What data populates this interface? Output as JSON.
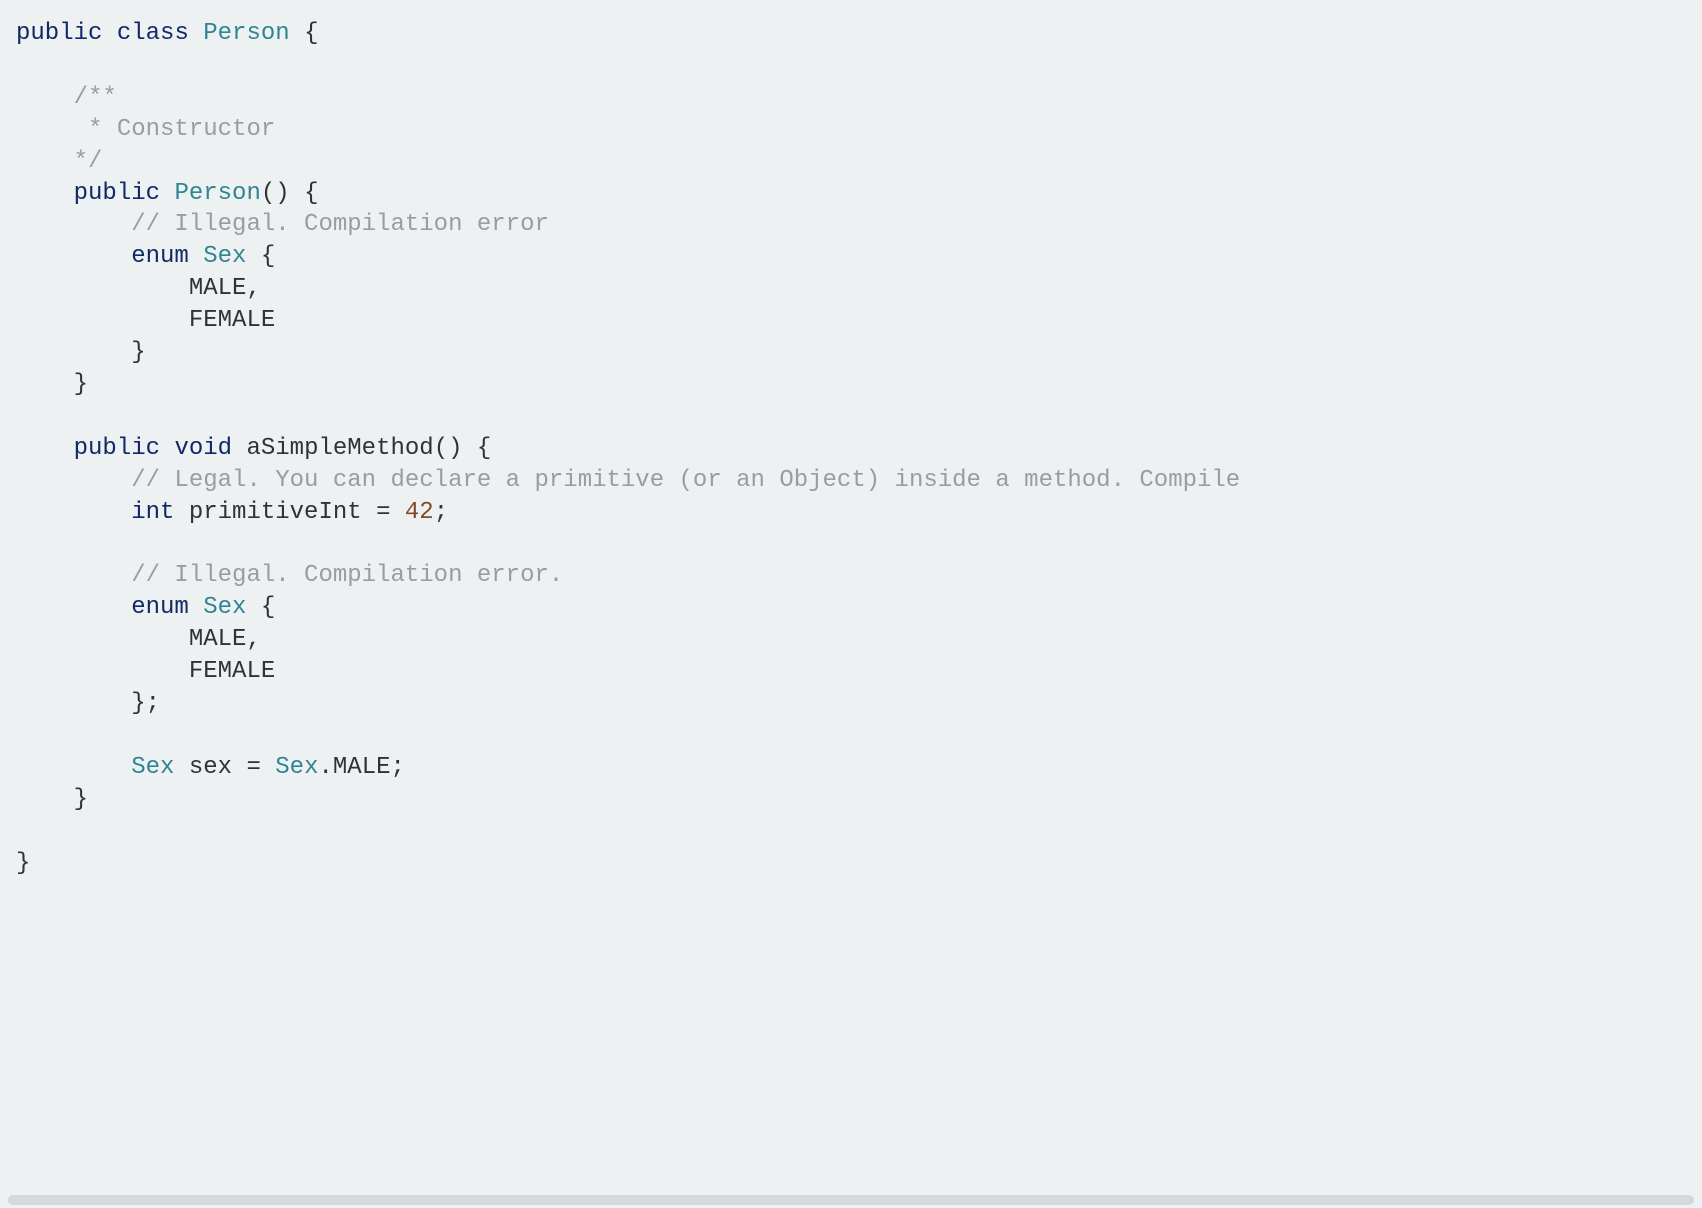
{
  "code": {
    "line1_kw1": "public",
    "line1_kw2": "class",
    "line1_type": "Person",
    "line1_brace": " {",
    "blank": "",
    "line2_comment": "    /**",
    "line3_comment": "     * Constructor",
    "line4_comment": "    */",
    "line5_indent": "    ",
    "line5_kw1": "public",
    "line5_sp": " ",
    "line5_type": "Person",
    "line5_rest": "() {",
    "line6_indent": "        ",
    "line6_comment": "// Illegal. Compilation error",
    "line7_indent": "        ",
    "line7_kw": "enum",
    "line7_sp": " ",
    "line7_type": "Sex",
    "line7_rest": " {",
    "line8": "            MALE,",
    "line9": "            FEMALE",
    "line10": "        }",
    "line11": "    }",
    "line12_indent": "    ",
    "line12_kw1": "public",
    "line12_sp1": " ",
    "line12_kw2": "void",
    "line12_sp2": " ",
    "line12_method": "aSimpleMethod",
    "line12_rest": "() {",
    "line13_indent": "        ",
    "line13_comment": "// Legal. You can declare a primitive (or an Object) inside a method. Compile",
    "line14_indent": "        ",
    "line14_kw": "int",
    "line14_var": " primitiveInt = ",
    "line14_num": "42",
    "line14_semi": ";",
    "line15_indent": "        ",
    "line15_comment": "// Illegal. Compilation error.",
    "line16_indent": "        ",
    "line16_kw": "enum",
    "line16_sp": " ",
    "line16_type": "Sex",
    "line16_rest": " {",
    "line17": "            MALE,",
    "line18": "            FEMALE",
    "line19": "        };",
    "line20_indent": "        ",
    "line20_type1": "Sex",
    "line20_var": " sex = ",
    "line20_type2": "Sex",
    "line20_rest": ".MALE;",
    "line21": "    }",
    "line22": "}"
  }
}
